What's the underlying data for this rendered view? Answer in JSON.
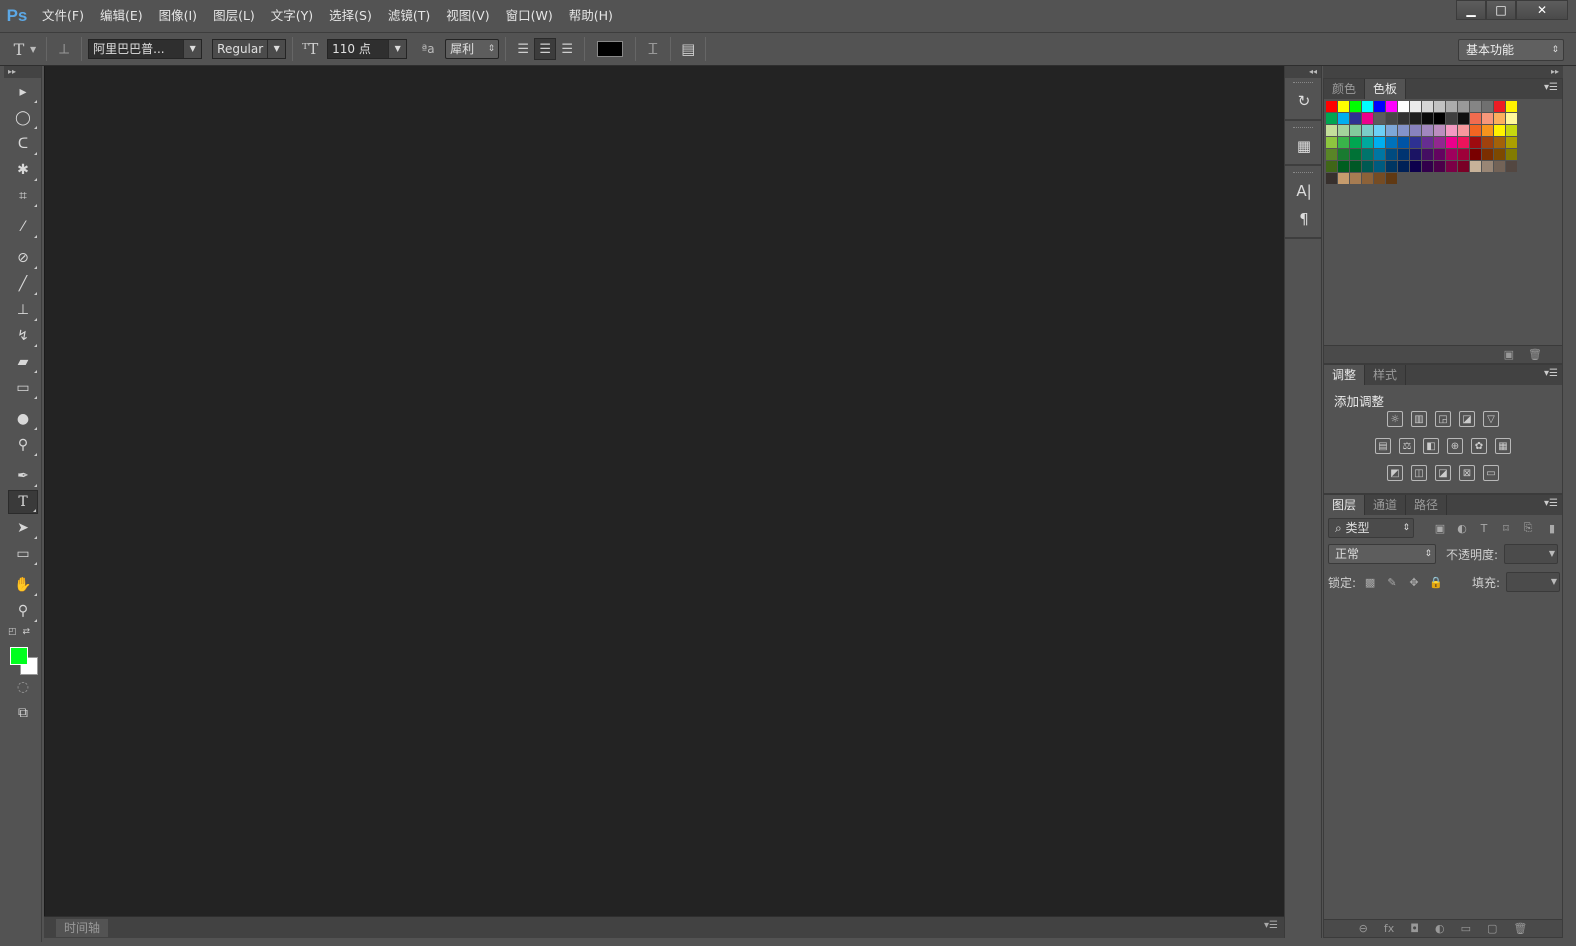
{
  "app": {
    "logo": "Ps"
  },
  "menu": [
    "文件(F)",
    "编辑(E)",
    "图像(I)",
    "图层(L)",
    "文字(Y)",
    "选择(S)",
    "滤镜(T)",
    "视图(V)",
    "窗口(W)",
    "帮助(H)"
  ],
  "window_controls": {
    "minimize": "▁",
    "maximize": "□",
    "close": "✕"
  },
  "options": {
    "tool_glyph": "T",
    "font_family": "阿里巴巴普...",
    "font_style": "Regular",
    "font_size": "110 点",
    "aa_label": "ªa",
    "antialias": "犀利",
    "text_color": "#000000",
    "workspace": "基本功能"
  },
  "colors": {
    "foreground": "#00ff1e",
    "background": "#ffffff",
    "canvas": "#232323"
  },
  "tools": [
    {
      "name": "move-tool-icon",
      "glyph": "▸"
    },
    {
      "name": "marquee-tool-icon",
      "glyph": "◯"
    },
    {
      "name": "lasso-tool-icon",
      "glyph": "ᑕ"
    },
    {
      "name": "magic-wand-tool-icon",
      "glyph": "✱"
    },
    {
      "name": "crop-tool-icon",
      "glyph": "⌗"
    },
    {
      "name": "eyedropper-tool-icon",
      "glyph": "⁄"
    },
    {
      "name": "healing-brush-tool-icon",
      "glyph": "⊘"
    },
    {
      "name": "brush-tool-icon",
      "glyph": "╱"
    },
    {
      "name": "stamp-tool-icon",
      "glyph": "⊥"
    },
    {
      "name": "history-brush-tool-icon",
      "glyph": "↯"
    },
    {
      "name": "eraser-tool-icon",
      "glyph": "▰"
    },
    {
      "name": "gradient-tool-icon",
      "glyph": "▭"
    },
    {
      "name": "blur-tool-icon",
      "glyph": "●"
    },
    {
      "name": "dodge-tool-icon",
      "glyph": "⚲"
    },
    {
      "name": "pen-tool-icon",
      "glyph": "✒"
    },
    {
      "name": "type-tool-icon",
      "glyph": "T"
    },
    {
      "name": "path-selection-tool-icon",
      "glyph": "➤"
    },
    {
      "name": "rectangle-tool-icon",
      "glyph": "▭"
    },
    {
      "name": "hand-tool-icon",
      "glyph": "✋"
    },
    {
      "name": "zoom-tool-icon",
      "glyph": "⚲"
    }
  ],
  "dock": [
    "↻",
    "▦",
    "A|",
    "¶"
  ],
  "swatches_panel": {
    "tabs": [
      "颜色",
      "色板"
    ],
    "active_tab": 1,
    "rows": [
      [
        "#ff0000",
        "#ffff00",
        "#00ff00",
        "#00ffff",
        "#0000ff",
        "#ff00ff",
        "#ffffff",
        "#ebebeb",
        "#d6d6d6",
        "#c2c2c2",
        "#adadad",
        "#999999",
        "#858585",
        "#707070",
        "#ed1c24",
        "#fff200"
      ],
      [
        "#00a651",
        "#00aeef",
        "#2e3192",
        "#ec008c",
        "#5c5c5c",
        "#474747",
        "#333333",
        "#1f1f1f",
        "#0a0a0a",
        "#000000",
        "#404040",
        "#101010",
        "#f26c4f",
        "#f7977a",
        "#fbaf5d",
        "#fff799"
      ],
      [
        "#c4df9b",
        "#a3d39c",
        "#82ca9c",
        "#7accc8",
        "#6dcff6",
        "#7ea7d8",
        "#8493ca",
        "#8882be",
        "#a187be",
        "#bc8dbf",
        "#f49ac2",
        "#f6989d",
        "#f26522",
        "#f7941d",
        "#fff200",
        "#c6d80f"
      ],
      [
        "#8dc63f",
        "#39b54a",
        "#00a651",
        "#00a99d",
        "#00aeef",
        "#0072bc",
        "#0054a6",
        "#2e3192",
        "#662d91",
        "#92278f",
        "#ec008c",
        "#ed145b",
        "#9e0b0f",
        "#a0410d",
        "#a36209",
        "#aba000"
      ],
      [
        "#598527",
        "#197b30",
        "#007236",
        "#00746b",
        "#0076a3",
        "#004b80",
        "#003471",
        "#1b1464",
        "#440e62",
        "#630460",
        "#9e005d",
        "#9e0039",
        "#790000",
        "#7b2e00",
        "#7d4900",
        "#827b00"
      ],
      [
        "#406618",
        "#005e20",
        "#005826",
        "#005952",
        "#005b7f",
        "#003663",
        "#002157",
        "#0d004c",
        "#32004b",
        "#4b0049",
        "#7b0046",
        "#7a0026",
        "#c7b299",
        "#998675",
        "#736357",
        "#534741"
      ],
      [
        "#37302d",
        "#c69c6d",
        "#a67c52",
        "#8c6239",
        "#754c24",
        "#603913"
      ]
    ]
  },
  "adjustments_panel": {
    "tabs": [
      "调整",
      "样式"
    ],
    "title": "添加调整",
    "row1": [
      "☼",
      "▥",
      "◲",
      "◪",
      "▽"
    ],
    "row2": [
      "▤",
      "⚖",
      "◧",
      "⊕",
      "✿",
      "▦"
    ],
    "row3": [
      "◩",
      "◫",
      "◪",
      "⊠",
      "▭"
    ]
  },
  "layers_panel": {
    "tabs": [
      "图层",
      "通道",
      "路径"
    ],
    "filter": "⌕ 类型",
    "blend_mode": "正常",
    "opacity_label": "不透明度:",
    "lock_label": "锁定:",
    "fill_label": "填充:",
    "footer_icons": [
      "⊖",
      "fx",
      "◘",
      "◐",
      "▭",
      "▢",
      "🗑"
    ]
  },
  "timeline": {
    "label": "时间轴"
  }
}
